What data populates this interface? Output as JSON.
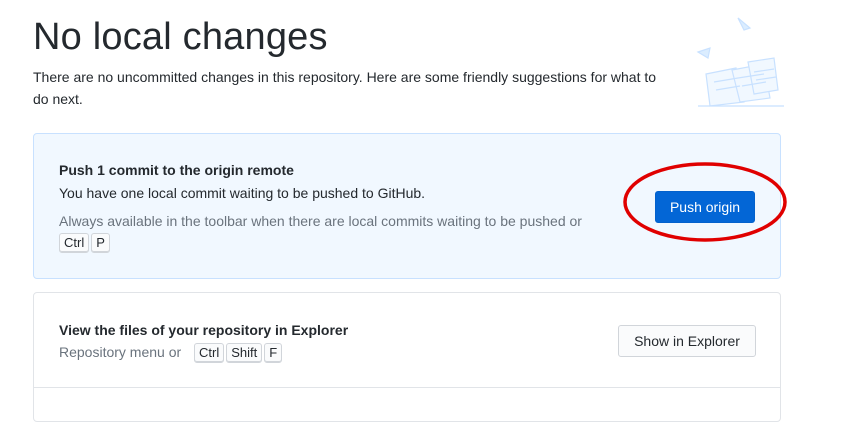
{
  "page": {
    "title": "No local changes",
    "subtitle": "There are no uncommitted changes in this repository. Here are some friendly suggestions for what to do next."
  },
  "push_card": {
    "title": "Push 1 commit to the origin remote",
    "description": "You have one local commit waiting to be pushed to GitHub.",
    "hint": "Always available in the toolbar when there are local commits waiting to be pushed or",
    "shortcut_keys": [
      "Ctrl",
      "P"
    ],
    "button_label": "Push origin",
    "button_color": "#0366d6"
  },
  "explorer_card": {
    "title": "View the files of your repository in Explorer",
    "hint": "Repository menu or",
    "shortcut_keys": [
      "Ctrl",
      "Shift",
      "F"
    ],
    "button_label": "Show in Explorer"
  },
  "annotation": {
    "color": "#e00000",
    "shape": "ellipse-highlight"
  },
  "illustration_icon": "paper-stack-illustration-icon"
}
